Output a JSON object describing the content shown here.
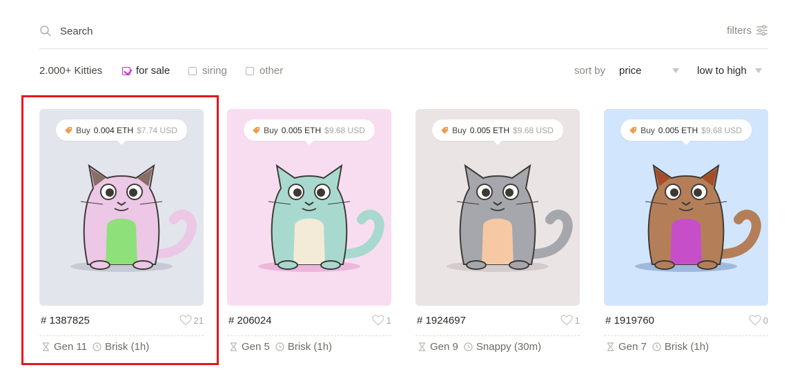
{
  "search": {
    "placeholder": "Search",
    "icon": "search-icon"
  },
  "filters": {
    "label": "filters",
    "icon": "sliders-icon"
  },
  "filter_row": {
    "count": "2.000+ Kitties",
    "options": [
      {
        "label": "for sale",
        "checked": true
      },
      {
        "label": "siring",
        "checked": false
      },
      {
        "label": "other",
        "checked": false
      }
    ],
    "sort_by_label": "sort by",
    "sort_field": "price",
    "sort_order": "low to high"
  },
  "colors": {
    "accent": "#c22cc1",
    "highlight": "#e8141b"
  },
  "kitties": [
    {
      "bg": "#e2e5eb",
      "buy": "Buy",
      "eth": "0.004 ETH",
      "usd": "$7.74 USD",
      "id": "# 1387825",
      "likes": "21",
      "gen": "Gen 11",
      "speed": "Brisk (1h)",
      "body": "#ecc7e6",
      "belly": "#8ee07a",
      "ear": "#6e5746",
      "shadow": "#c6cad6"
    },
    {
      "bg": "#f8ddf0",
      "buy": "Buy",
      "eth": "0.005 ETH",
      "usd": "$9.68 USD",
      "id": "# 206024",
      "likes": "1",
      "gen": "Gen 5",
      "speed": "Brisk (1h)",
      "body": "#a8d9cf",
      "belly": "#f3ebd7",
      "ear": "#a8d9cf",
      "shadow": "#ebb7dd"
    },
    {
      "bg": "#eae4e4",
      "buy": "Buy",
      "eth": "0.005 ETH",
      "usd": "$9.68 USD",
      "id": "# 1924697",
      "likes": "1",
      "gen": "Gen 9",
      "speed": "Snappy (30m)",
      "body": "#a6a6ad",
      "belly": "#f6c9a4",
      "ear": "#a6a6ad",
      "shadow": "#d4cccb"
    },
    {
      "bg": "#d1e5fd",
      "buy": "Buy",
      "eth": "0.005 ETH",
      "usd": "$9.68 USD",
      "id": "# 1919760",
      "likes": "0",
      "gen": "Gen 7",
      "speed": "Brisk (1h)",
      "body": "#b47f58",
      "belly": "#c64fc9",
      "ear": "#a3401d",
      "shadow": "#9fb9dc"
    }
  ]
}
